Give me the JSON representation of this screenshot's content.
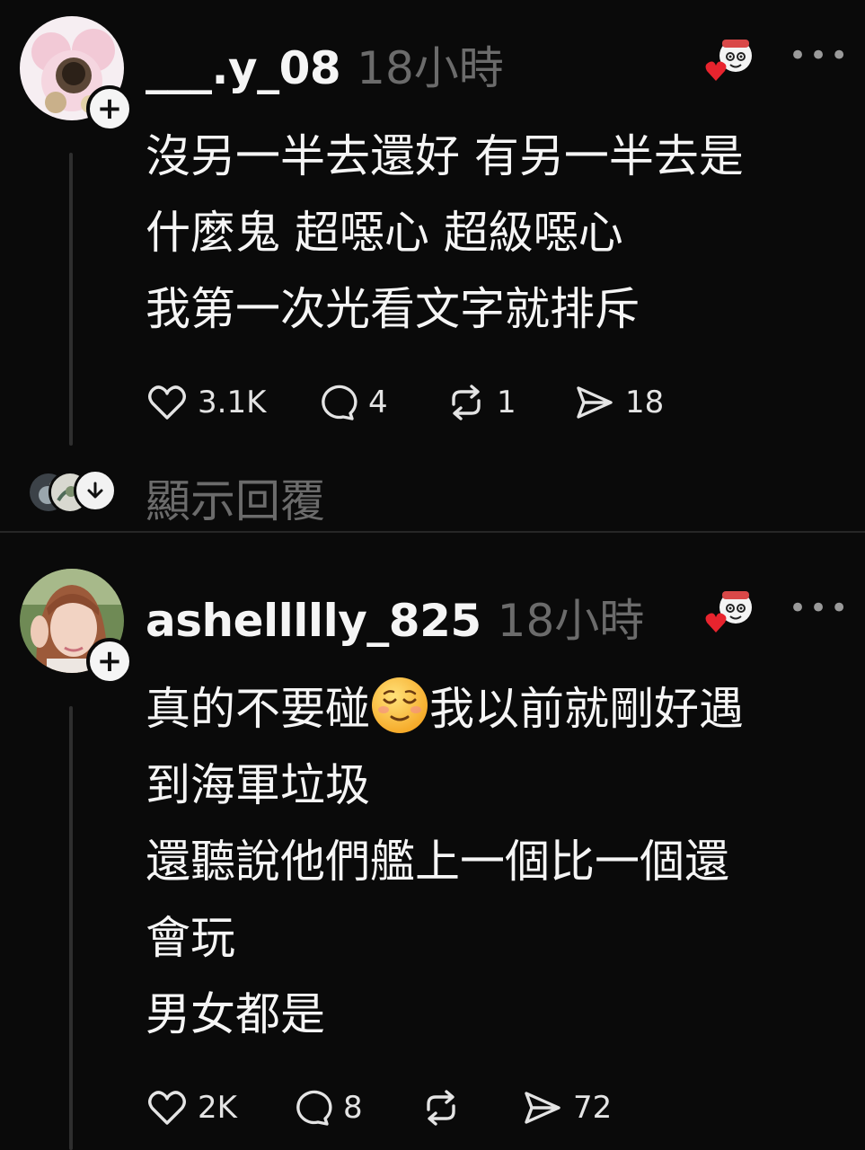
{
  "posts": [
    {
      "username": "___.y_08",
      "time": "18小時",
      "body": [
        "沒另一半去還好 有另一半去是",
        "什麼鬼 超噁心 超級噁心",
        "我第一次光看文字就排斥"
      ],
      "likes": "3.1K",
      "comments": "4",
      "reposts": "1",
      "shares": "18"
    },
    {
      "username": "ashellllly_825",
      "time": "18小時",
      "body_first_before": "真的不要碰",
      "body_first_after": "我以前就剛好遇",
      "body_rest": [
        "到海軍垃圾",
        "還聽說他們艦上一個比一個還",
        "會玩",
        "男女都是"
      ],
      "likes": "2K",
      "comments": "8",
      "reposts": "",
      "shares": "72"
    }
  ],
  "show_replies": "顯示回覆",
  "icons": {
    "like": "heart-icon",
    "comment": "comment-bubble-icon",
    "repost": "repost-icon",
    "share": "send-icon",
    "more": "more-dots-icon",
    "follow": "plus-icon",
    "reaction": "heart-sticker-icon",
    "expand": "arrow-down-icon",
    "emoji": "relieved-face-emoji"
  },
  "colors": {
    "background": "#0a0a0a",
    "text": "#f5f5f5",
    "muted": "#6b6b6b",
    "heart": "#e8242e"
  }
}
